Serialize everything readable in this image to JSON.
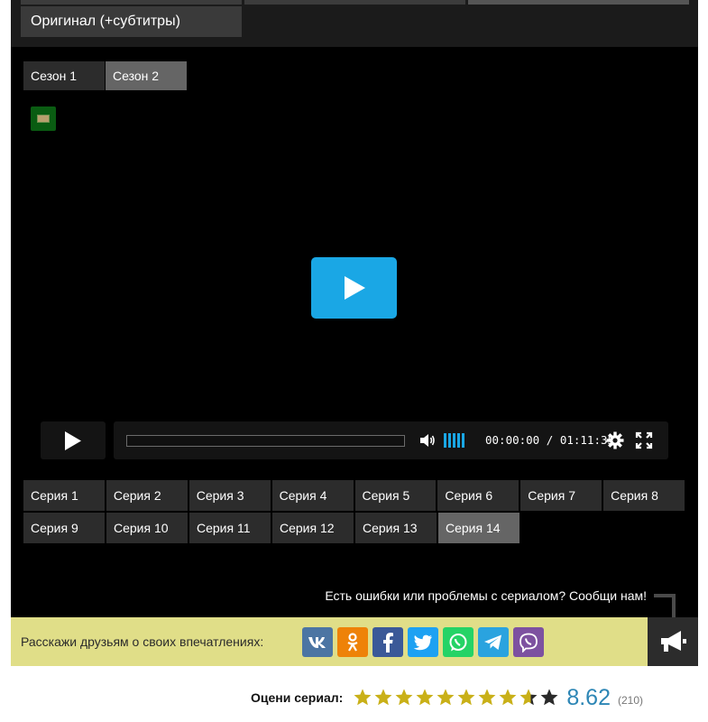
{
  "translation": {
    "tab_label": "Оригинал (+субтитры)"
  },
  "player": {
    "seasons": [
      {
        "label": "Сезон 1",
        "active": false
      },
      {
        "label": "Сезон 2",
        "active": true
      }
    ],
    "current_time": "00:00:00",
    "time_separator": "/",
    "duration": "01:11:35",
    "progress_fraction": 0.0,
    "volume_level_bars": 5,
    "accent_color": "#1aa7e5",
    "episodes_row1": [
      {
        "label": "Серия 1"
      },
      {
        "label": "Серия 2"
      },
      {
        "label": "Серия 3"
      },
      {
        "label": "Серия 4"
      },
      {
        "label": "Серия 5"
      },
      {
        "label": "Серия 6"
      },
      {
        "label": "Серия 7"
      },
      {
        "label": "Серия 8"
      }
    ],
    "episodes_row2": [
      {
        "label": "Серия 9"
      },
      {
        "label": "Серия 10"
      },
      {
        "label": "Серия 11"
      },
      {
        "label": "Серия 12"
      },
      {
        "label": "Серия 13"
      },
      {
        "label": "Серия 14"
      }
    ],
    "active_episode": "Серия 14",
    "report_text": "Есть ошибки или проблемы с сериалом? Сообщи нам!"
  },
  "share": {
    "label": "Расскажи друзьям о своих впечатлениях:",
    "buttons": [
      {
        "icon": "vk-icon",
        "color": "#4c75a3"
      },
      {
        "icon": "odnoklassniki-icon",
        "color": "#ee8208"
      },
      {
        "icon": "facebook-icon",
        "color": "#3b5998"
      },
      {
        "icon": "twitter-icon",
        "color": "#1da1f2"
      },
      {
        "icon": "whatsapp-icon",
        "color": "#25d366"
      },
      {
        "icon": "telegram-icon",
        "color": "#2aa3df"
      },
      {
        "icon": "viber-icon",
        "color": "#7d51a0"
      }
    ],
    "report_icon": "megaphone-icon"
  },
  "rating": {
    "label": "Оцени сериал:",
    "value": "8.62",
    "count": "(210)",
    "stars_total": 10,
    "stars_filled": 8.62,
    "star_color": "#c9b018"
  }
}
